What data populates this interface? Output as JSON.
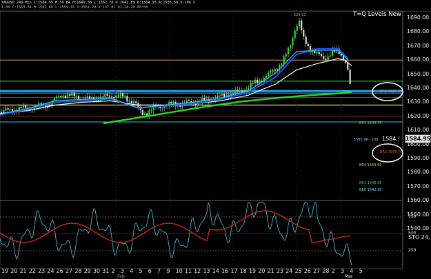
{
  "header": {
    "line1": "XAUUSD 240-Min  C:1584.95  H:59.84  H:1649.38  L:1562.78  O:1642.89  B:1584.95  A:1585.58  V:106.5",
    "line2": "1.00  C:1563.34  H:1582.69  L:1559.16  O:1561.70  V:137.81  01-28-20  00:00"
  },
  "chart_title": "T=Q Levels New",
  "high_label": "529.12",
  "price_axis": [
    "1690.00",
    "1680.00",
    "1670.00",
    "1660.00",
    "1650.00",
    "1640.00",
    "1630.00",
    "1620.00",
    "1610.00",
    "1600.00",
    "1590.00",
    "1580.00",
    "1570.00",
    "1560.00",
    "1550.00",
    "1540.00"
  ],
  "current_price": "1584.95",
  "level_labels": [
    {
      "text": "BR3 1627.93",
      "color": "#e08a4c"
    },
    {
      "text": "BR1 1598.78",
      "color": "#52d152"
    },
    {
      "text": "1583.96 - 200",
      "color": "#8fd3ff"
    },
    {
      "text": "BR2 1576.79",
      "color": "#e0564c"
    },
    {
      "text": "BR4 1563.95",
      "color": "#e8d64c"
    },
    {
      "text": "BR1 1548.36",
      "color": "#52d152"
    },
    {
      "text": "BR0 1542.35",
      "color": "#8fd3ff"
    }
  ],
  "price_marker": "1584.!",
  "x_axis": [
    "19",
    "20",
    "21",
    "22",
    "23",
    "24",
    "26",
    "27",
    "28",
    "29",
    "30",
    "31",
    "2",
    "3",
    "4",
    "5",
    "6",
    "7",
    "9",
    "10",
    "11",
    "12",
    "13",
    "14",
    "16",
    "17",
    "18",
    "19",
    "20",
    "21",
    "23",
    "24",
    "25",
    "26",
    "27",
    "28",
    "2",
    "3",
    "4",
    "5"
  ],
  "x_sub": {
    "text": "Feb",
    "highlight": "Mar"
  },
  "osc_axis": [
    "750",
    "500",
    "250"
  ],
  "osc_label": "STO 24,",
  "colors": {
    "bg": "#000000",
    "ma_blue": "#2a4bff",
    "ma_cyan": "#20d0e0",
    "ma_white": "#ffffff",
    "ma_green": "#2ad42a",
    "osc_line": "#4bb0c8",
    "osc_red": "#c8281e"
  }
}
